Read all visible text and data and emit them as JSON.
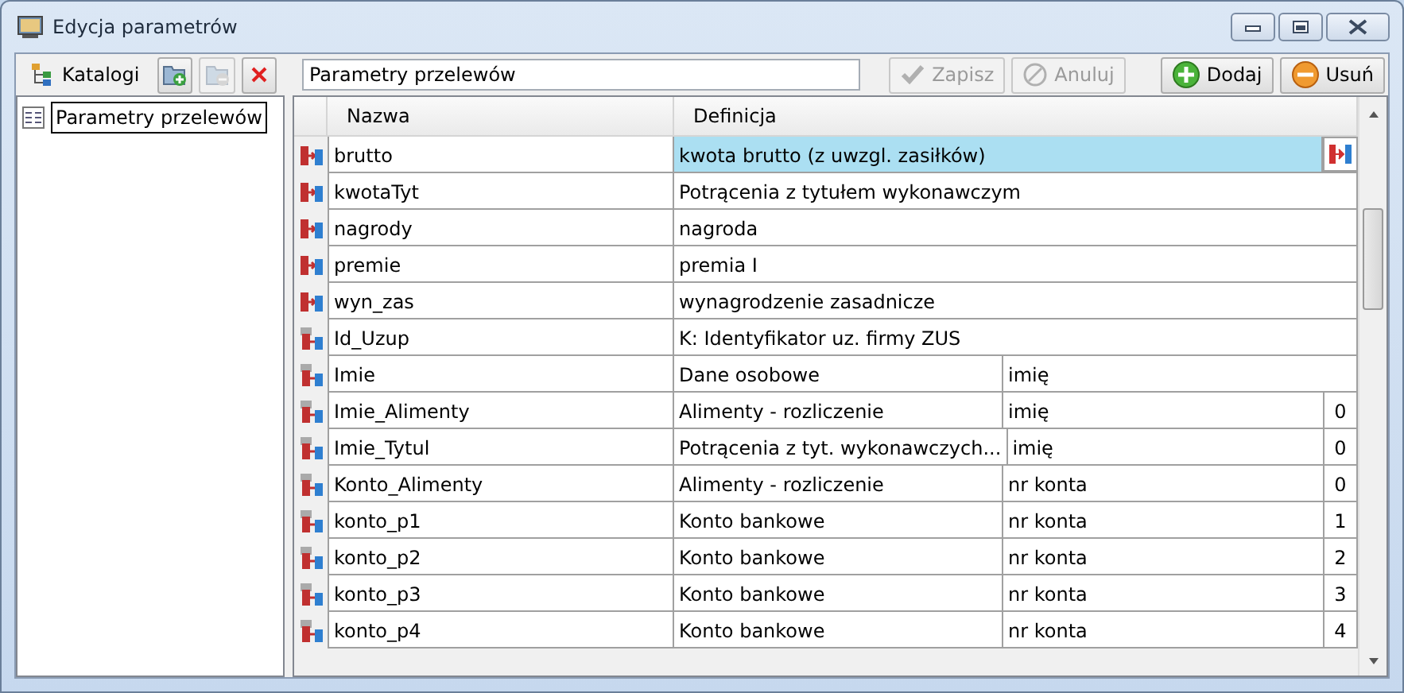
{
  "window": {
    "title": "Edycja parametrów"
  },
  "toolbar": {
    "catalogs_label": "Katalogi",
    "add_folder": {
      "disabled": false
    },
    "remove_folder": {
      "disabled": true
    },
    "delete": {
      "disabled": false
    },
    "name_value": "Parametry przelewów",
    "buttons": [
      {
        "label": "Zapisz",
        "kind": "save",
        "disabled": true
      },
      {
        "label": "Anuluj",
        "kind": "cancel",
        "disabled": true
      },
      {
        "label": "Dodaj",
        "kind": "add",
        "disabled": false
      },
      {
        "label": "Usuń",
        "kind": "remove",
        "disabled": false
      }
    ]
  },
  "tree": {
    "items": [
      {
        "label": "Parametry przelewów",
        "selected": true
      }
    ]
  },
  "table": {
    "columns": [
      "Nazwa",
      "Definicja"
    ],
    "rows": [
      {
        "kind": "local",
        "name": "brutto",
        "definition": "kwota brutto (z uwzgl. zasiłków)",
        "selected": true
      },
      {
        "kind": "local",
        "name": "kwotaTyt",
        "definition": "Potrącenia z tytułem wykonawczym",
        "selected": false
      },
      {
        "kind": "local",
        "name": "nagrody",
        "definition": "nagroda",
        "selected": false
      },
      {
        "kind": "local",
        "name": "premie",
        "definition": "premia I",
        "selected": false
      },
      {
        "kind": "local",
        "name": "wyn_zas",
        "definition": "wynagrodzenie zasadnicze",
        "selected": false
      },
      {
        "kind": "external",
        "name": "Id_Uzup",
        "definition": "K: Identyfikator uz. firmy ZUS",
        "selected": false
      },
      {
        "kind": "external",
        "name": "Imie",
        "definition": "Dane osobowe",
        "field": "imię",
        "selected": false
      },
      {
        "kind": "external",
        "name": "Imie_Alimenty",
        "definition": "Alimenty - rozliczenie",
        "field": "imię",
        "index": "0",
        "selected": false
      },
      {
        "kind": "external",
        "name": "Imie_Tytul",
        "definition": "Potrącenia z tyt. wykonawczych...",
        "field": "imię",
        "index": "0",
        "selected": false
      },
      {
        "kind": "external",
        "name": "Konto_Alimenty",
        "definition": "Alimenty - rozliczenie",
        "field": "nr konta",
        "index": "0",
        "selected": false
      },
      {
        "kind": "external",
        "name": "konto_p1",
        "definition": "Konto bankowe",
        "field": "nr konta",
        "index": "1",
        "selected": false
      },
      {
        "kind": "external",
        "name": "konto_p2",
        "definition": "Konto bankowe",
        "field": "nr konta",
        "index": "2",
        "selected": false
      },
      {
        "kind": "external",
        "name": "konto_p3",
        "definition": "Konto bankowe",
        "field": "nr konta",
        "index": "3",
        "selected": false
      },
      {
        "kind": "external",
        "name": "konto_p4",
        "definition": "Konto bankowe",
        "field": "nr konta",
        "index": "4",
        "selected": false
      }
    ]
  }
}
